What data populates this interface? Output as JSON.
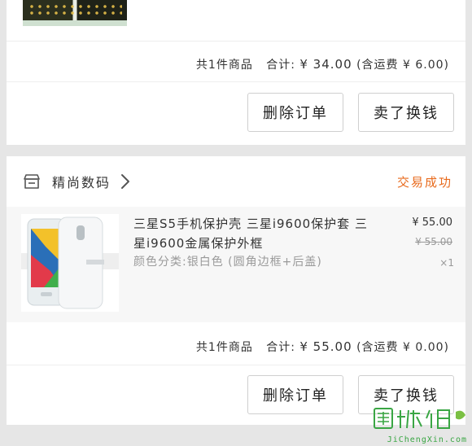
{
  "order1": {
    "summary_count": "共1件商品",
    "summary_total_label": "合计:",
    "summary_total": "¥ 34.00",
    "summary_shipping": "(含运费 ¥ 6.00)",
    "delete_label": "删除订单",
    "sell_label": "卖了换钱"
  },
  "order2": {
    "shop_name": "精尚数码",
    "status": "交易成功",
    "item_title": "三星S5手机保护壳 三星i9600保护套 三星i9600金属保护外框",
    "item_spec": "颜色分类:银白色 (圆角边框+后盖)",
    "price": "¥ 55.00",
    "original_price": "¥ 55.00",
    "quantity": "×1",
    "summary_count": "共1件商品",
    "summary_total_label": "合计:",
    "summary_total": "¥ 55.00",
    "summary_shipping": "(含运费 ¥ 0.00)",
    "delete_label": "删除订单",
    "sell_label": "卖了换钱"
  },
  "watermark": {
    "text": "JiChengXin.com"
  },
  "colors": {
    "accent_orange": "#e86a1c",
    "background": "#e6e6e6",
    "watermark_green": "#3aa644"
  }
}
